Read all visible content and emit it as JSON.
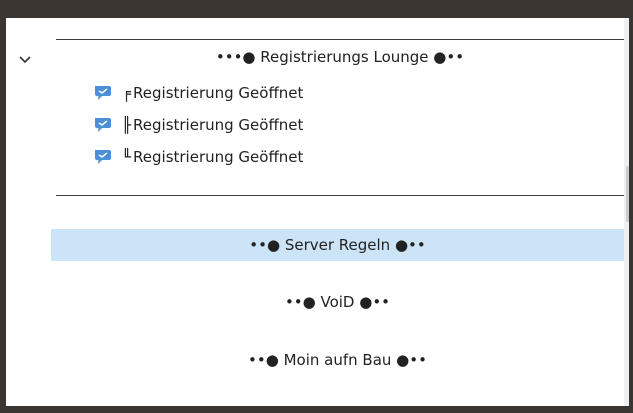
{
  "tree": {
    "category": {
      "title": "•••● Registrierungs Lounge ●••",
      "expanded": true,
      "channels": [
        {
          "glyph": "╒",
          "label": "Registrierung Geöffnet",
          "icon": "speech-bubble-icon"
        },
        {
          "glyph": "╟",
          "label": "Registrierung Geöffnet",
          "icon": "speech-bubble-icon"
        },
        {
          "glyph": "╙",
          "label": "Registrierung Geöffnet",
          "icon": "speech-bubble-icon"
        }
      ]
    },
    "rows": [
      {
        "label": "••● Server Regeln ●••",
        "selected": true
      },
      {
        "label": "••● VoiD ●••",
        "selected": false
      },
      {
        "label": "••● Moin aufn Bau ●••",
        "selected": false
      }
    ]
  },
  "colors": {
    "frame": "#3a3531",
    "selection": "#cce4f7",
    "icon": "#5b9bd5",
    "text": "#222222"
  }
}
